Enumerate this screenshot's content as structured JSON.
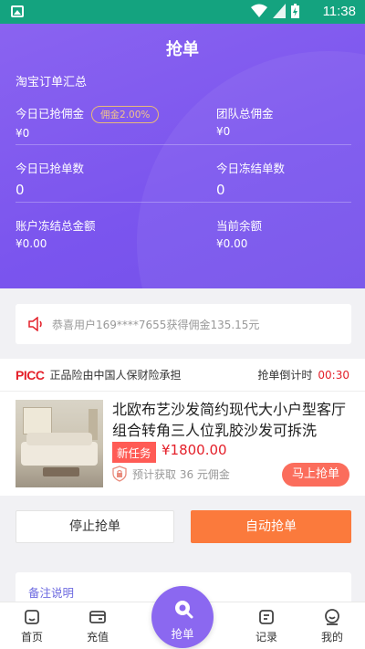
{
  "status_bar": {
    "time": "11:38"
  },
  "header": {
    "title": "抢单",
    "section_title": "淘宝订单汇总",
    "commission_badge": "佣金2.00%",
    "stats": [
      {
        "label": "今日已抢佣金",
        "value": "¥0"
      },
      {
        "label": "团队总佣金",
        "value": "¥0"
      },
      {
        "label": "今日已抢单数",
        "value": "0"
      },
      {
        "label": "今日冻结单数",
        "value": "0"
      },
      {
        "label": "账户冻结总金额",
        "value": "¥0.00"
      },
      {
        "label": "当前余额",
        "value": "¥0.00"
      }
    ]
  },
  "notice": {
    "text": "恭喜用户169****7655获得佣金135.15元"
  },
  "task": {
    "insurer_logo": "PICC",
    "insurer_text": "正品险由中国人保财险承担",
    "countdown_label": "抢单倒计时",
    "countdown_value": "00:30",
    "product_name": "北欧布艺沙发简约现代大小户型客厅组合转角三人位乳胶沙发可拆洗",
    "tag": "新任务",
    "price": "¥1800.00",
    "estimate": "预计获取 36 元佣金",
    "grab_button": "马上抢单"
  },
  "actions": {
    "stop": "停止抢单",
    "auto": "自动抢单"
  },
  "remarks": {
    "title": "备注说明"
  },
  "nav": {
    "home": "首页",
    "recharge": "充值",
    "grab": "抢单",
    "records": "记录",
    "mine": "我的"
  },
  "colors": {
    "primary": "#7b55ee",
    "accent": "#fb7a3c",
    "status_bar": "#14a37f",
    "price": "#e4202a"
  }
}
